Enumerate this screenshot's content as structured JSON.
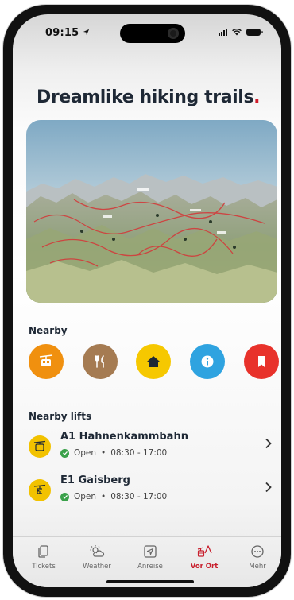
{
  "status": {
    "time": "09:15"
  },
  "header": {
    "title": "Dreamlike hiking trails",
    "title_dot": "."
  },
  "nearby": {
    "label": "Nearby",
    "items": [
      {
        "icon": "cable-car-icon",
        "color": "#f0900f"
      },
      {
        "icon": "restaurant-icon",
        "color": "#a57b52"
      },
      {
        "icon": "house-icon",
        "color": "#f6c800"
      },
      {
        "icon": "info-icon",
        "color": "#2fa3e0"
      },
      {
        "icon": "bookmark-icon",
        "color": "#e8322b"
      }
    ]
  },
  "lifts": {
    "label": "Nearby lifts",
    "items": [
      {
        "name": "A1 Hahnenkammbahn",
        "status": "Open",
        "separator": "•",
        "hours": "08:30 - 17:00",
        "icon": "gondola-icon"
      },
      {
        "name": "E1 Gaisberg",
        "status": "Open",
        "separator": "•",
        "hours": "08:30 - 17:00",
        "icon": "chairlift-icon"
      }
    ]
  },
  "tabbar": {
    "tabs": [
      {
        "label": "Tickets",
        "icon": "tickets-icon",
        "active": false
      },
      {
        "label": "Weather",
        "icon": "weather-icon",
        "active": false
      },
      {
        "label": "Anreise",
        "icon": "navigation-icon",
        "active": false
      },
      {
        "label": "Vor Ort",
        "icon": "on-site-icon",
        "active": true
      },
      {
        "label": "Mehr",
        "icon": "more-icon",
        "active": false
      }
    ],
    "active_color": "#c8202e"
  }
}
